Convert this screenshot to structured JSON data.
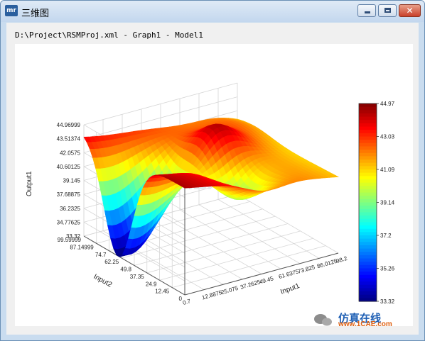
{
  "window": {
    "icon_text": "mr",
    "title": "三维图",
    "minimize_icon": "minimize-icon",
    "maximize_icon": "maximize-icon",
    "close_icon": "close-icon"
  },
  "path": "D:\\Project\\RSMProj.xml - Graph1 - Model1",
  "chart_data": {
    "type": "surface",
    "xlabel": "Input1",
    "ylabel": "Input2",
    "zlabel": "Output1",
    "x_ticks": [
      "0.7",
      "12.8875",
      "25.075",
      "37.2625",
      "49.45",
      "61.6375",
      "73.825",
      "86.0125",
      "98.2"
    ],
    "y_ticks": [
      "0",
      "12.45",
      "24.9",
      "37.35",
      "49.8",
      "62.25",
      "74.7",
      "87.14999",
      "99.59999"
    ],
    "z_ticks": [
      "33.32",
      "34.77625",
      "36.2325",
      "37.68875",
      "39.145",
      "40.60125",
      "42.0575",
      "43.51374",
      "44.96999"
    ],
    "colorbar_ticks": [
      "44.97",
      "43.03",
      "41.09",
      "39.14",
      "37.2",
      "35.26",
      "33.32"
    ],
    "zlim": [
      33.32,
      44.97
    ],
    "colors": [
      "#ff0000",
      "#ff8000",
      "#ffff00",
      "#80ff00",
      "#00ff00",
      "#00ff80",
      "#00ffff",
      "#0080ff",
      "#0000ff"
    ],
    "grid": true,
    "watermark": "1CAE.COM"
  },
  "brand": {
    "wechat_icon": "wechat-icon",
    "text1": "仿真在线",
    "text2": "www.1CAE.com"
  }
}
